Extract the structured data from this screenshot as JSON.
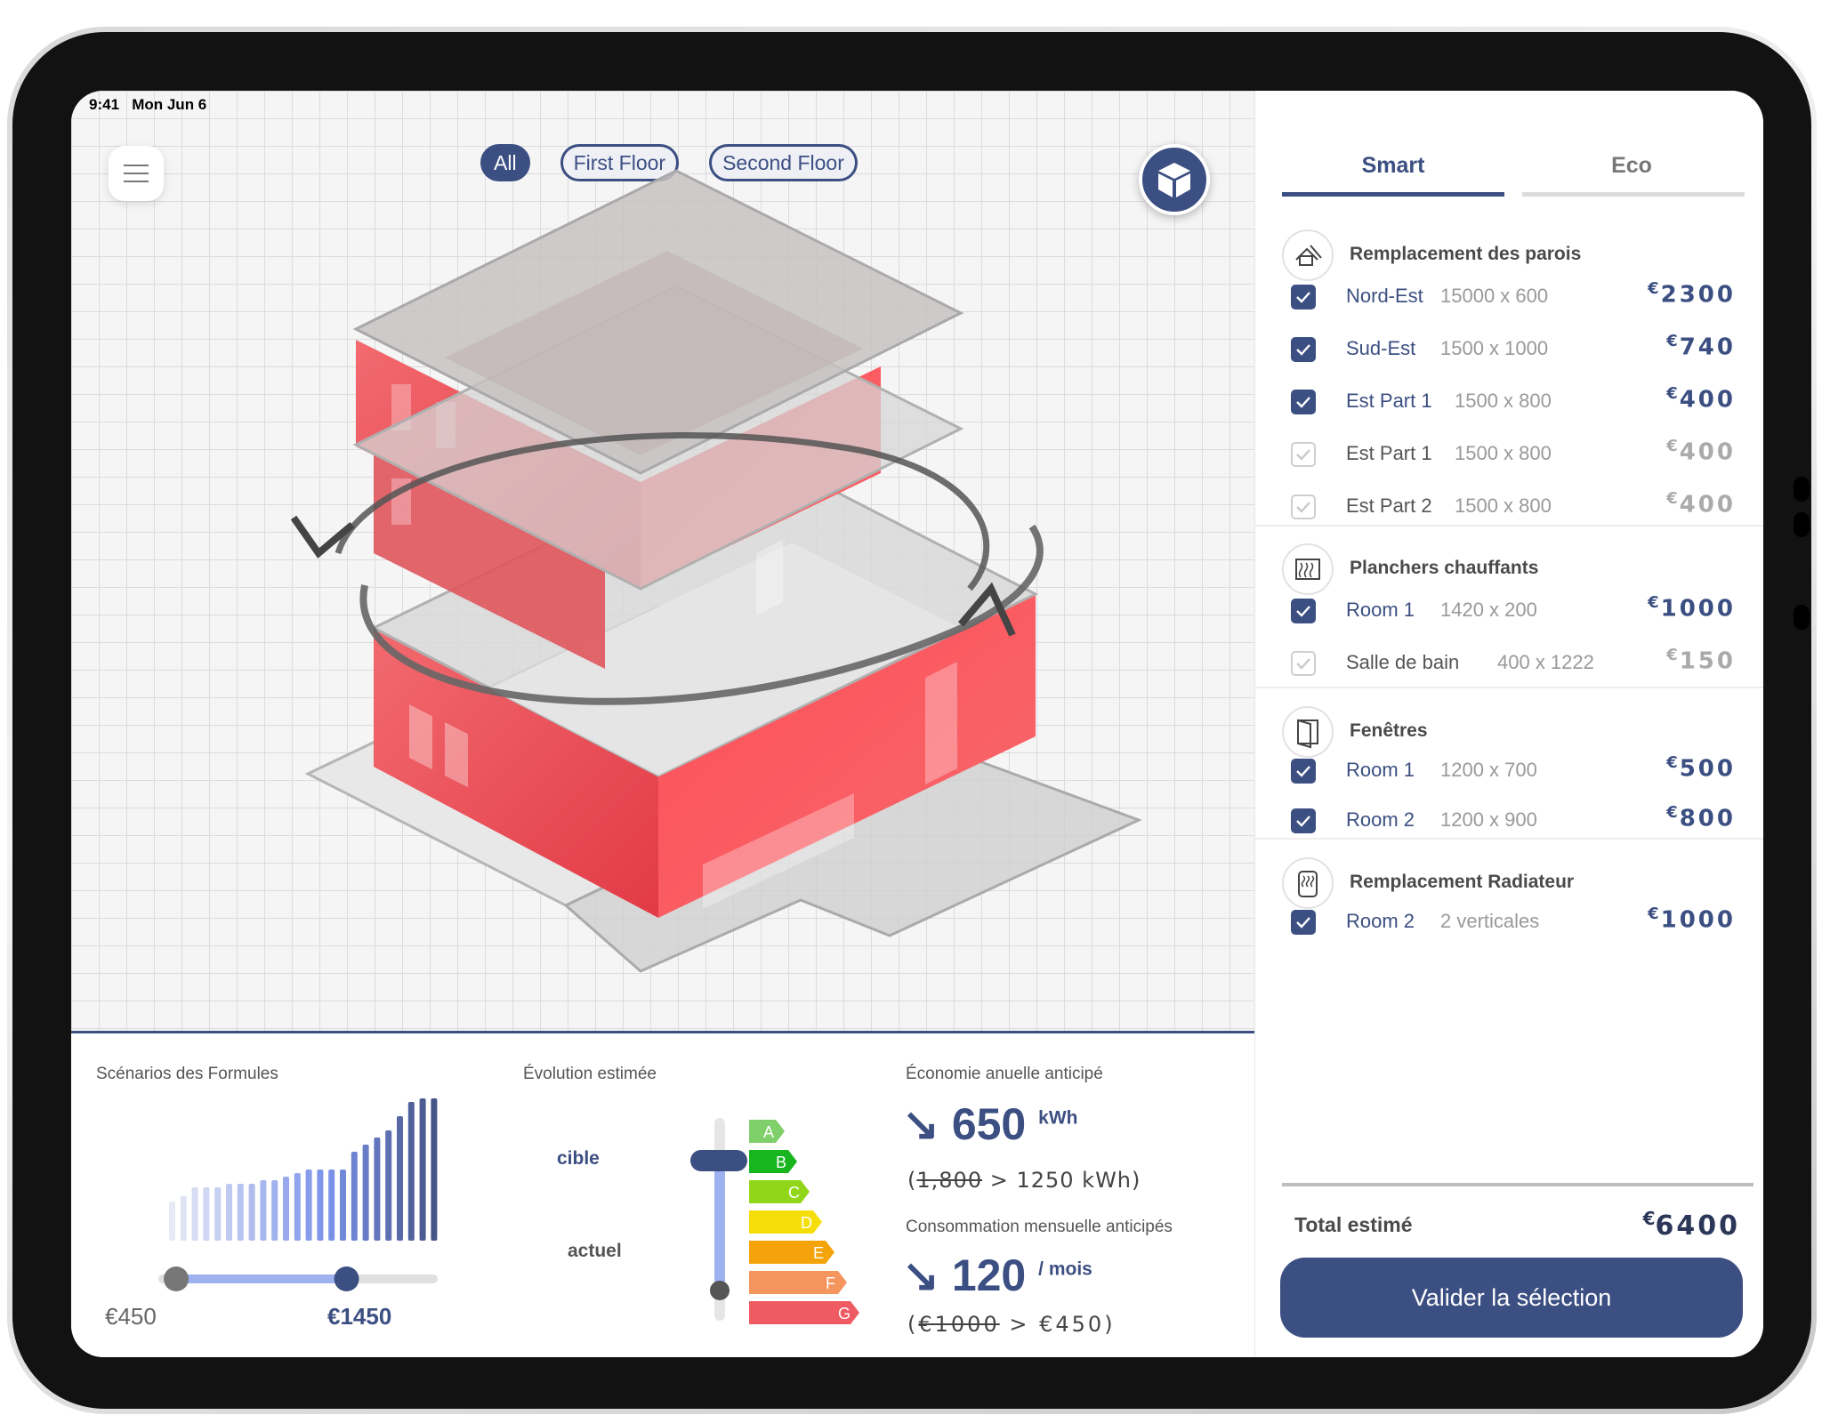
{
  "status_bar": {
    "time": "9:41",
    "date": "Mon Jun 6"
  },
  "floors": [
    {
      "label": "All",
      "active": true
    },
    {
      "label": "First Floor",
      "active": false
    },
    {
      "label": "Second Floor",
      "active": false
    }
  ],
  "icons": {
    "menu": "hamburger-menu-icon",
    "view": "cube-icon",
    "rotate": "rotate-arrows-icon"
  },
  "bottom": {
    "scenarios": {
      "title": "Scénarios des Formules",
      "bar_heights": [
        0.22,
        0.25,
        0.3,
        0.3,
        0.3,
        0.32,
        0.32,
        0.32,
        0.34,
        0.34,
        0.36,
        0.38,
        0.4,
        0.4,
        0.4,
        0.4,
        0.5,
        0.54,
        0.58,
        0.62,
        0.7,
        0.78,
        0.8,
        0.8
      ],
      "range_min": "€450",
      "range_max": "€1450",
      "slider_low": 0.0,
      "slider_high": 0.61
    },
    "evolution": {
      "title": "Évolution estimée",
      "target_label": "cible",
      "current_label": "actuel",
      "classes": [
        "A",
        "B",
        "C",
        "D",
        "E",
        "F",
        "G"
      ],
      "class_colors": [
        "#7fcf6a",
        "#19b51f",
        "#92d61a",
        "#f5de0a",
        "#f5a30a",
        "#f5955e",
        "#ef5b62"
      ]
    },
    "economy": {
      "title": "Économie anuelle anticipé",
      "value": "650",
      "unit": "kWh",
      "detail_old": "1,800",
      "detail_new": "1250 kWh",
      "monthly_title": "Consommation mensuelle anticipés",
      "monthly_value": "120",
      "monthly_unit": "/ mois",
      "monthly_old": "€1000",
      "monthly_new": "€450"
    }
  },
  "right_panel": {
    "tabs": [
      {
        "label": "Smart",
        "active": true
      },
      {
        "label": "Eco",
        "active": false
      }
    ],
    "sections": [
      {
        "title": "Remplacement des parois",
        "icon": "house-tools-icon",
        "rows": [
          {
            "name": "Nord-Est",
            "dim": "15000 x 600",
            "price": "2300",
            "checked": true
          },
          {
            "name": "Sud-Est",
            "dim": "1500 x 1000",
            "price": "740",
            "checked": true
          },
          {
            "name": "Est Part 1",
            "dim": "1500 x 800",
            "price": "400",
            "checked": true
          },
          {
            "name": "Est Part 1",
            "dim": "1500 x 800",
            "price": "400",
            "checked": false
          },
          {
            "name": "Est Part 2",
            "dim": "1500 x 800",
            "price": "400",
            "checked": false
          }
        ]
      },
      {
        "title": "Planchers chauffants",
        "icon": "heated-floor-icon",
        "rows": [
          {
            "name": "Room 1",
            "dim": "1420 x 200",
            "price": "1000",
            "checked": true
          },
          {
            "name": "Salle de bain",
            "dim": "400 x 1222",
            "price": "150",
            "checked": false
          }
        ]
      },
      {
        "title": "Fenêtres",
        "icon": "window-icon",
        "rows": [
          {
            "name": "Room 1",
            "dim": "1200 x 700",
            "price": "500",
            "checked": true
          },
          {
            "name": "Room 2",
            "dim": "1200 x 900",
            "price": "800",
            "checked": true
          }
        ]
      },
      {
        "title": "Remplacement Radiateur",
        "icon": "radiator-icon",
        "rows": [
          {
            "name": "Room 2",
            "dim": "2 verticales",
            "price": "1000",
            "checked": true
          }
        ]
      }
    ],
    "currency": "€",
    "total_label": "Total estimé",
    "total_value": "6400",
    "validate_label": "Valider la sélection"
  },
  "colors": {
    "primary": "#3c4f82",
    "wall_red": "#f0454f",
    "grid": "#dcdcdc"
  }
}
